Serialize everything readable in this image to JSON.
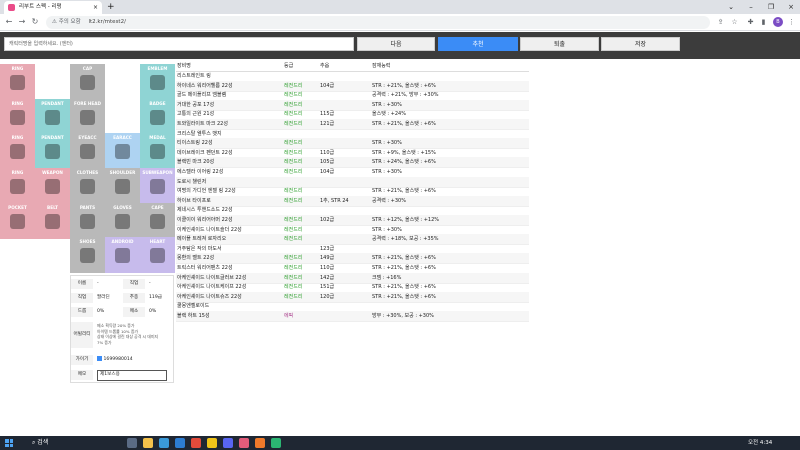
{
  "tab": {
    "title": "리부트 스펙 - 리펑",
    "close": "×"
  },
  "newtab": "+",
  "window_controls": [
    "⌄",
    "–",
    "❐",
    "×"
  ],
  "nav": {
    "back": "←",
    "forward": "→",
    "reload": "↻"
  },
  "address": {
    "security_text": "주의 요함",
    "url": "lt2.kr/mtest2/"
  },
  "profile_initial": "B",
  "search": {
    "placeholder": "캐릭터명을 입력하세요. (엔터)"
  },
  "buttons": {
    "next": "다음",
    "recommend": "추천",
    "shop": "퇴출",
    "save": "저장"
  },
  "slots": [
    {
      "label": "RING",
      "color": "pink"
    },
    {
      "label": "CAP",
      "color": "gray"
    },
    {
      "label": "EMBLEM",
      "color": "teal"
    },
    {
      "label": "RING",
      "color": "pink"
    },
    {
      "label": "PENDANT",
      "color": "teal"
    },
    {
      "label": "FORE HEAD",
      "color": "gray"
    },
    {
      "label": "BADGE",
      "color": "teal"
    },
    {
      "label": "RING",
      "color": "pink"
    },
    {
      "label": "PENDANT",
      "color": "teal"
    },
    {
      "label": "EYEACC",
      "color": "gray"
    },
    {
      "label": "EARACC",
      "color": "blue"
    },
    {
      "label": "MEDAL",
      "color": "teal"
    },
    {
      "label": "RING",
      "color": "pink"
    },
    {
      "label": "WEAPON",
      "color": "pink"
    },
    {
      "label": "CLOTHES",
      "color": "gray"
    },
    {
      "label": "SHOULDER",
      "color": "gray"
    },
    {
      "label": "SUBWEAPON",
      "color": "violet"
    },
    {
      "label": "POCKET",
      "color": "pink"
    },
    {
      "label": "BELT",
      "color": "pink"
    },
    {
      "label": "PANTS",
      "color": "gray"
    },
    {
      "label": "GLOVES",
      "color": "gray"
    },
    {
      "label": "CAPE",
      "color": "gray"
    },
    {
      "label": "SHOES",
      "color": "gray"
    },
    {
      "label": "ANDROID",
      "color": "violet"
    },
    {
      "label": "HEART",
      "color": "violet"
    }
  ],
  "table": {
    "headers": [
      "장비명",
      "등급",
      "추옵",
      "잠재능력"
    ],
    "rows": [
      [
        "리스트레인트 링",
        "",
        "",
        ""
      ],
      [
        "하이네스 워리어헬름 22성",
        "레전드리",
        "104급",
        "STR : +21%, 올스탯 : +6%"
      ],
      [
        "골드 메이플리프 엠블렘",
        "레전드리",
        "",
        "공격력 : +21%, 방무 : +30%"
      ],
      [
        "거대한 공포 17성",
        "레전드리",
        "",
        "STR : +30%"
      ],
      [
        "고통의 근원 21성",
        "레전드리",
        "115급",
        "올스탯 : +24%"
      ],
      [
        "트와일라이트 마크 22성",
        "레전드리",
        "121급",
        "STR : +21%, 올스탯 : +6%"
      ],
      [
        "크리스탈 웬투스 뱃지",
        "",
        "",
        ""
      ],
      [
        "티이스트링 22성",
        "레전드리",
        "",
        "STR : +30%"
      ],
      [
        "데이브레이크 펜던트 22성",
        "레전드리",
        "110급",
        "STR : +9%, 올스탯 : +15%"
      ],
      [
        "블랙빈 마크 20성",
        "레전드리",
        "105급",
        "STR : +24%, 올스탯 : +6%"
      ],
      [
        "에스텔라 이어링 22성",
        "레전드리",
        "104급",
        "STR : +30%"
      ],
      [
        "도로시 챌린저",
        "",
        "",
        ""
      ],
      [
        "여명의 가디언 엔젤 링 22성",
        "레전드리",
        "",
        "STR : +21%, 올스탯 : +6%"
      ],
      [
        "하이브 타이프로",
        "레전드리",
        "1추, STR 24",
        "공격력 : +30%"
      ],
      [
        "제네시스 투핸드소드 22성",
        "",
        "",
        ""
      ],
      [
        "이클이이 워리어아머 22성",
        "레전드리",
        "102급",
        "STR : +12%, 올스탯 : +12%"
      ],
      [
        "이케인셰이드 나이트숄더 22성",
        "레전드리",
        "",
        "STR : +30%"
      ],
      [
        "메이플 트레져 로자리오",
        "레전드리",
        "",
        "공격력 : +18%, 보공 : +35%"
      ],
      [
        "거주탐은 작의 마도서",
        "",
        "123급",
        ""
      ],
      [
        "몽환의 벨트 22성",
        "레전드리",
        "149급",
        "STR : +21%, 올스탯 : +6%"
      ],
      [
        "트릭스터 워리어팬츠 22성",
        "레전드리",
        "110급",
        "STR : +21%, 올스탯 : +6%"
      ],
      [
        "아케인셰이드 나이트글러브 22성",
        "레전드리",
        "142급",
        "크뎀 : +16%"
      ],
      [
        "아케인셰이드 나이트케이프 22성",
        "레전드리",
        "151급",
        "STR : +21%, 올스탯 : +6%"
      ],
      [
        "아케인셰이드 나이트슈즈 22성",
        "레전드리",
        "120급",
        "STR : +21%, 올스탯 : +6%"
      ],
      [
        "쿨몽엔젤로이드",
        "",
        "",
        ""
      ],
      [
        "블랙 하트 15성",
        "에픽",
        "",
        "방무 : +30%, 보공 : +30%"
      ]
    ]
  },
  "info": {
    "name_label": "이름",
    "name_value": "-",
    "job_label": "직업",
    "job_value": "-",
    "class_label": "직업",
    "class_value": "팔라딘",
    "level_label": "추종",
    "level_value": "119급",
    "drop_label": "드롭",
    "drop_value": "0%",
    "meso_label": "메소",
    "meso_value": "0%",
    "option_label": "어빌리티",
    "option_lines": [
      "메소 획득량 20% 증가",
      "아이템 드롭률 10% 증가",
      "상태 이상에 걸린 대상 공격 시 데미지",
      "7% 증가"
    ],
    "cash_label": "가이기",
    "cash_value": "1699980014",
    "memo_label": "메모",
    "memo_value": "제1보스용"
  },
  "taskbar": {
    "search": "검색",
    "time": "오전 4:34"
  }
}
